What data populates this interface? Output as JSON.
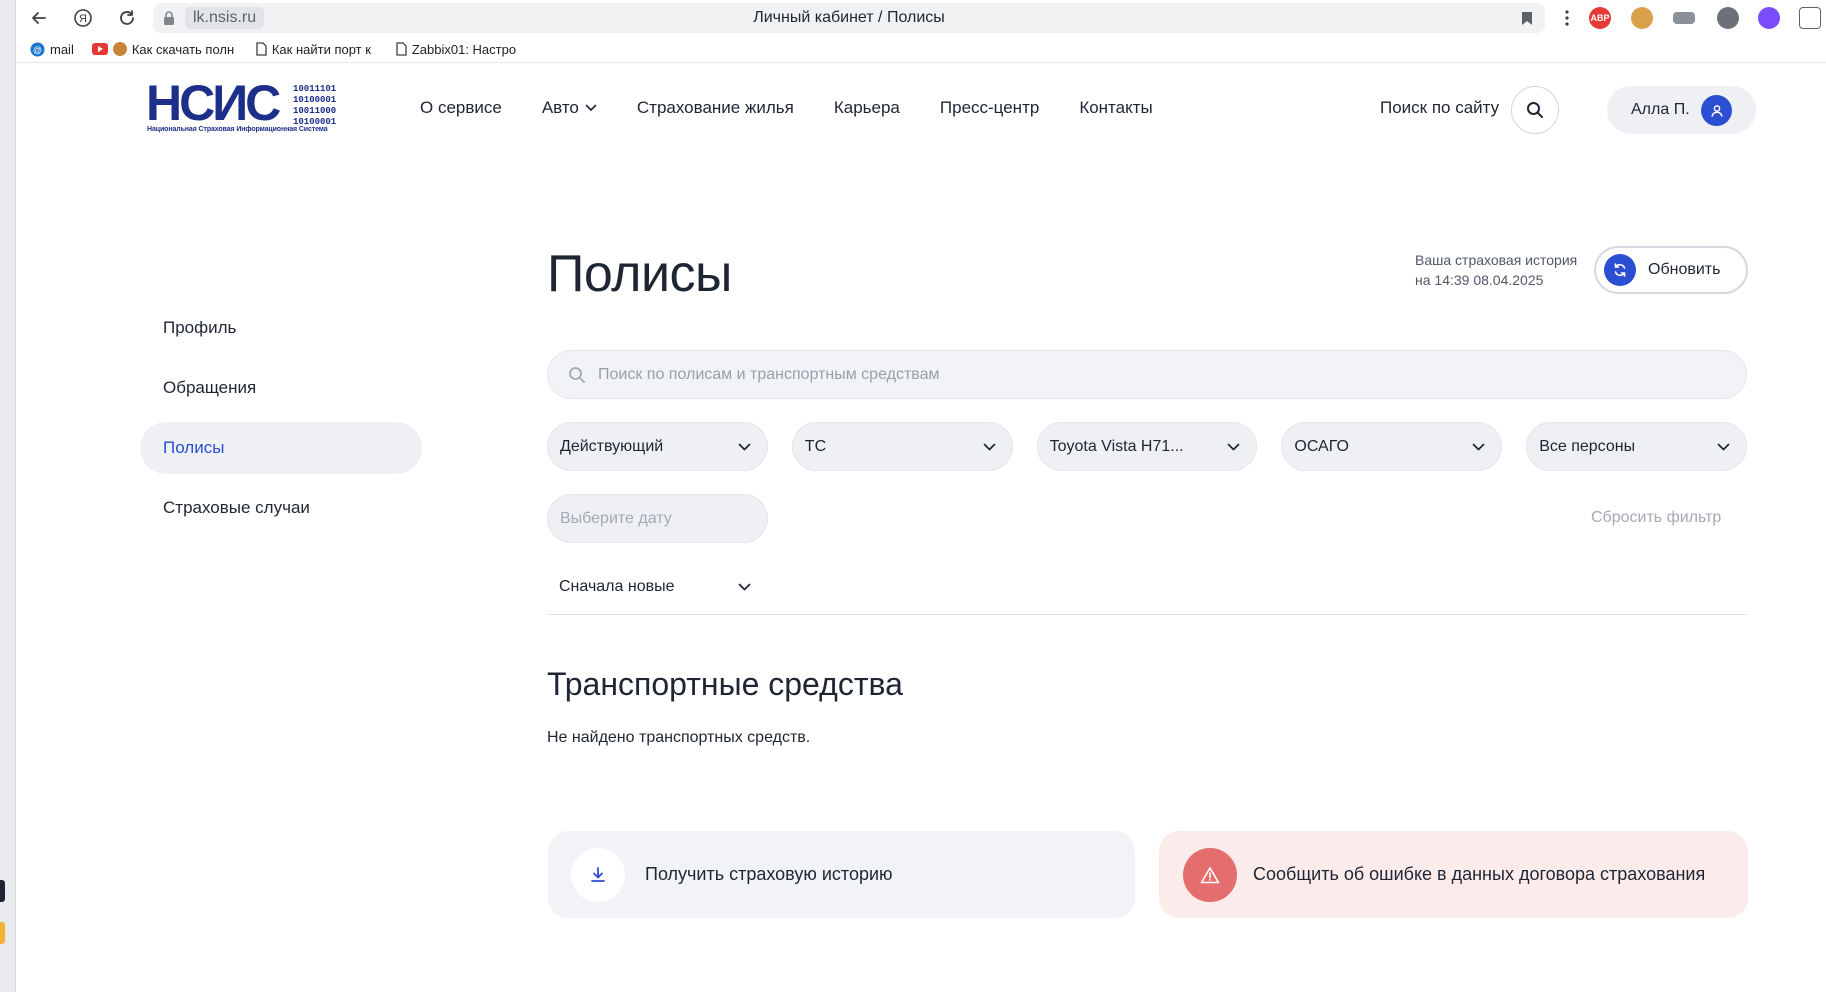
{
  "browser": {
    "domain": "lk.nsis.ru",
    "tab_title": "Личный кабинет / Полисы",
    "bookmarks": [
      {
        "label": "mail",
        "icon": "mail-icon"
      },
      {
        "label": "Как скачать полн",
        "icon": "youtube-icon"
      },
      {
        "label": "Как найти порт к",
        "icon": "page-icon"
      },
      {
        "label": "Zabbix01: Настро",
        "icon": "page-icon"
      }
    ],
    "extensions": [
      {
        "name": "adblock-icon",
        "label": "ABP",
        "color": "#e53935"
      }
    ]
  },
  "site": {
    "logo_text": "НСИС",
    "logo_bits": [
      "10011101",
      "10100001",
      "10011000",
      "10100001"
    ],
    "logo_subtitle": "Национальная Страховая Информационная Система",
    "nav": [
      "О сервисе",
      "Авто",
      "Страхование жилья",
      "Карьера",
      "Пресс-центр",
      "Контакты"
    ],
    "search_label": "Поиск по сайту",
    "user_name": "Алла П."
  },
  "sidebar": {
    "items": [
      {
        "label": "Профиль",
        "active": false
      },
      {
        "label": "Обращения",
        "active": false
      },
      {
        "label": "Полисы",
        "active": true
      },
      {
        "label": "Страховые случаи",
        "active": false
      }
    ]
  },
  "main": {
    "title": "Полисы",
    "history_line1": "Ваша страховая история",
    "history_line2": "на 14:39 08.04.2025",
    "refresh_label": "Обновить",
    "search_placeholder": "Поиск по полисам и транспортным средствам",
    "filters": [
      "Действующий",
      "ТС",
      "Toyota Vista H71...",
      "ОСАГО",
      "Все персоны"
    ],
    "date_placeholder": "Выберите дату",
    "reset_filter": "Сбросить фильтр",
    "sort_label": "Сначала новые",
    "section_title": "Транспортные средства",
    "empty_text": "Не найдено транспортных средств.",
    "card_history": "Получить страховую историю",
    "card_error": "Сообщить об ошибке в данных договора страхования"
  },
  "colors": {
    "accent": "#2c4ed3",
    "logo": "#1e2f8a",
    "error": "#e46d6d",
    "error_bg": "#fbeceb"
  }
}
